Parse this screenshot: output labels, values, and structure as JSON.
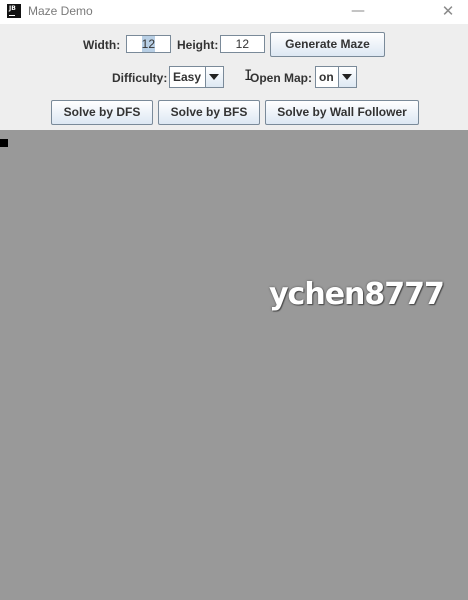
{
  "window": {
    "icon_text": "JB",
    "title": "Maze Demo",
    "minimize_glyph": "—",
    "close_glyph": "✕"
  },
  "controls": {
    "width_label": "Width:",
    "width_value": "12",
    "height_label": "Height:",
    "height_value": "12",
    "generate_label": "Generate Maze",
    "difficulty_label": "Difficulty:",
    "difficulty_value": "Easy",
    "open_map_label": "Open Map:",
    "open_map_value": "on"
  },
  "solve_buttons": {
    "dfs": "Solve by DFS",
    "bfs": "Solve by BFS",
    "wall_follower": "Solve by Wall Follower"
  },
  "canvas": {
    "watermark": "ychen8777"
  },
  "cursor": {
    "glyph": "I"
  },
  "colors": {
    "canvas_bg": "#999999",
    "toolbar_bg": "#eeeeee",
    "selection": "#b8cfe5"
  }
}
